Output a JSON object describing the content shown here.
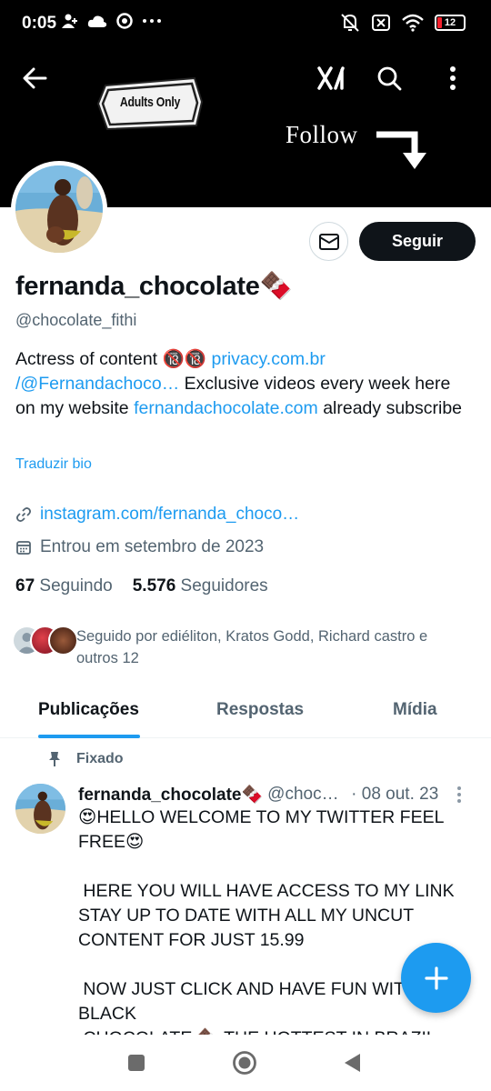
{
  "status_bar": {
    "time": "0:05",
    "battery_level": "12",
    "icons": [
      "person-add-icon",
      "cloud-icon",
      "chrome-icon",
      "more-dots-icon",
      "mute-icon",
      "sim-off-icon",
      "wifi-icon",
      "battery-icon"
    ]
  },
  "header": {
    "banner_badge": "Adults Only",
    "banner_follow": "Follow",
    "icons": [
      "back-arrow-icon",
      "grok-icon",
      "search-icon",
      "more-vertical-icon"
    ]
  },
  "actions": {
    "follow_label": "Seguir",
    "message_icon": "envelope-icon"
  },
  "profile": {
    "display_name": "fernanda_chocolate🍫",
    "handle": "@chocolate_fithi",
    "bio_part1": "Actress of content 🔞🔞 ",
    "bio_link1": "privacy.com.br /@Fernandachoco…",
    "bio_part2": "  Exclusive videos every week here on my website ",
    "bio_link2": "fernandachocolate.com",
    "bio_part3": " already subscribe",
    "translate_label": "Traduzir bio",
    "website": "instagram.com/fernanda_choco…",
    "joined": "Entrou em setembro de 2023",
    "following_count": "67",
    "following_label": "Seguindo",
    "followers_count": "5.576",
    "followers_label": "Seguidores",
    "followed_by": "Seguido por ediéliton, Kratos Godd, Richard castro e outros 12"
  },
  "tabs": [
    {
      "label": "Publicações",
      "active": true
    },
    {
      "label": "Respostas",
      "active": false
    },
    {
      "label": "Mídia",
      "active": false
    }
  ],
  "pinned_tweet": {
    "pinned_label": "Fixado",
    "name": "fernanda_chocolate🍫",
    "handle": "@chocolate_fithi",
    "date": "· 08 out. 23",
    "text": "😍HELLO WELCOME TO MY TWITTER FEEL FREE😍\n\n HERE YOU WILL HAVE ACCESS TO MY LINK STAY UP TO DATE WITH ALL MY UNCUT CONTENT FOR JUST 15.99\n\n NOW JUST CLICK AND HAVE FUN WITH BLACK\n CHOCOLATE 🍫 THE HOTTEST IN BRAZIL"
  },
  "colors": {
    "accent": "#1d9bf0",
    "text": "#0f1419",
    "secondary": "#536471",
    "banner": "#000000"
  }
}
